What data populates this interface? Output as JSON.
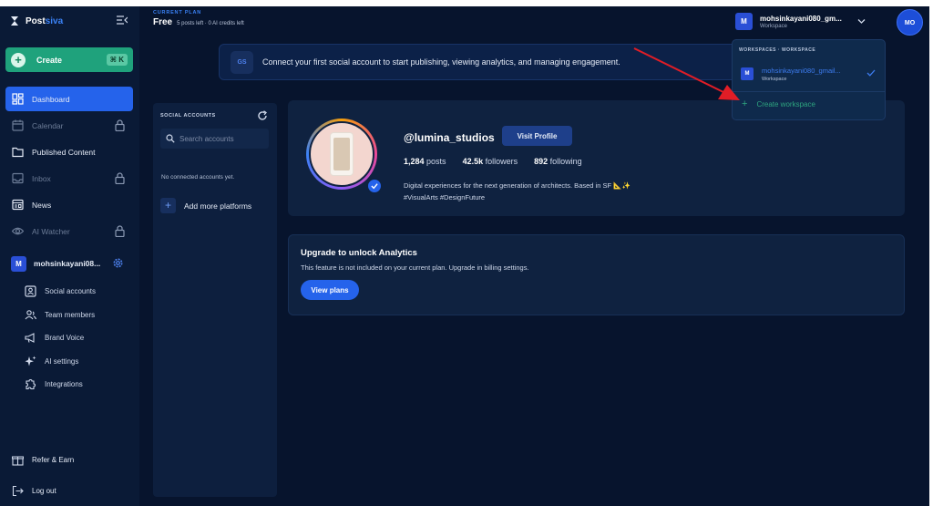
{
  "brand": {
    "name_main": "Post",
    "name_accent": "siva"
  },
  "create": {
    "label": "Create",
    "shortcut": "⌘ K"
  },
  "nav": [
    {
      "id": "dashboard",
      "label": "Dashboard",
      "icon": "dashboard-icon",
      "locked": false,
      "active": true
    },
    {
      "id": "calendar",
      "label": "Calendar",
      "icon": "calendar-icon",
      "locked": true,
      "active": false
    },
    {
      "id": "published",
      "label": "Published Content",
      "icon": "folder-icon",
      "locked": false,
      "active": false
    },
    {
      "id": "inbox",
      "label": "Inbox",
      "icon": "inbox-icon",
      "locked": true,
      "active": false
    },
    {
      "id": "news",
      "label": "News",
      "icon": "news-icon",
      "locked": false,
      "active": false
    },
    {
      "id": "ai-watcher",
      "label": "AI Watcher",
      "icon": "eye-icon",
      "locked": true,
      "active": false
    }
  ],
  "sidebar_workspace": {
    "initial": "M",
    "name": "mohsinkayani08..."
  },
  "subnav": [
    {
      "id": "social-accounts",
      "label": "Social accounts",
      "icon": "id-card-icon"
    },
    {
      "id": "team-members",
      "label": "Team members",
      "icon": "team-icon"
    },
    {
      "id": "brand-voice",
      "label": "Brand Voice",
      "icon": "megaphone-icon"
    },
    {
      "id": "ai-settings",
      "label": "AI settings",
      "icon": "sparkle-icon"
    },
    {
      "id": "integrations",
      "label": "Integrations",
      "icon": "puzzle-icon"
    }
  ],
  "footer": {
    "refer": "Refer & Earn",
    "logout": "Log out"
  },
  "plan": {
    "caption": "CURRENT PLAN",
    "name": "Free",
    "credits": "5 posts left · 0 AI credits left"
  },
  "topbar_workspace": {
    "initial": "M",
    "name": "mohsinkayani080_gm...",
    "sub": "Workspace"
  },
  "user": {
    "initials": "MO"
  },
  "banner": {
    "badge": "GS",
    "text": "Connect your first social account to start publishing, viewing analytics, and managing engagement."
  },
  "social_panel": {
    "title": "SOCIAL ACCOUNTS",
    "search_placeholder": "Search accounts",
    "empty": "No connected accounts yet.",
    "add_label": "Add more platforms"
  },
  "profile": {
    "handle": "@lumina_studios",
    "visit_label": "Visit Profile",
    "posts_value": "1,284",
    "posts_label": "posts",
    "followers_value": "42.5k",
    "followers_label": "followers",
    "following_value": "892",
    "following_label": "following",
    "bio_line1": "Digital experiences for the next generation of architects. Based in SF 📐✨",
    "bio_line2": "#VisualArts #DesignFuture"
  },
  "analytics": {
    "title": "Upgrade to unlock Analytics",
    "text": "This feature is not included on your current plan. Upgrade in billing settings.",
    "button": "View plans"
  },
  "dropdown": {
    "caption": "WORKSPACES · WORKSPACE",
    "item_initial": "M",
    "item_name": "mohsinkayani080_gmail...",
    "item_sub": "Workspace",
    "create_label": "Create workspace"
  },
  "colors": {
    "accent": "#2563eb",
    "create_green": "#1fa27c",
    "background": "#07142d",
    "arrow": "#e11d26"
  }
}
